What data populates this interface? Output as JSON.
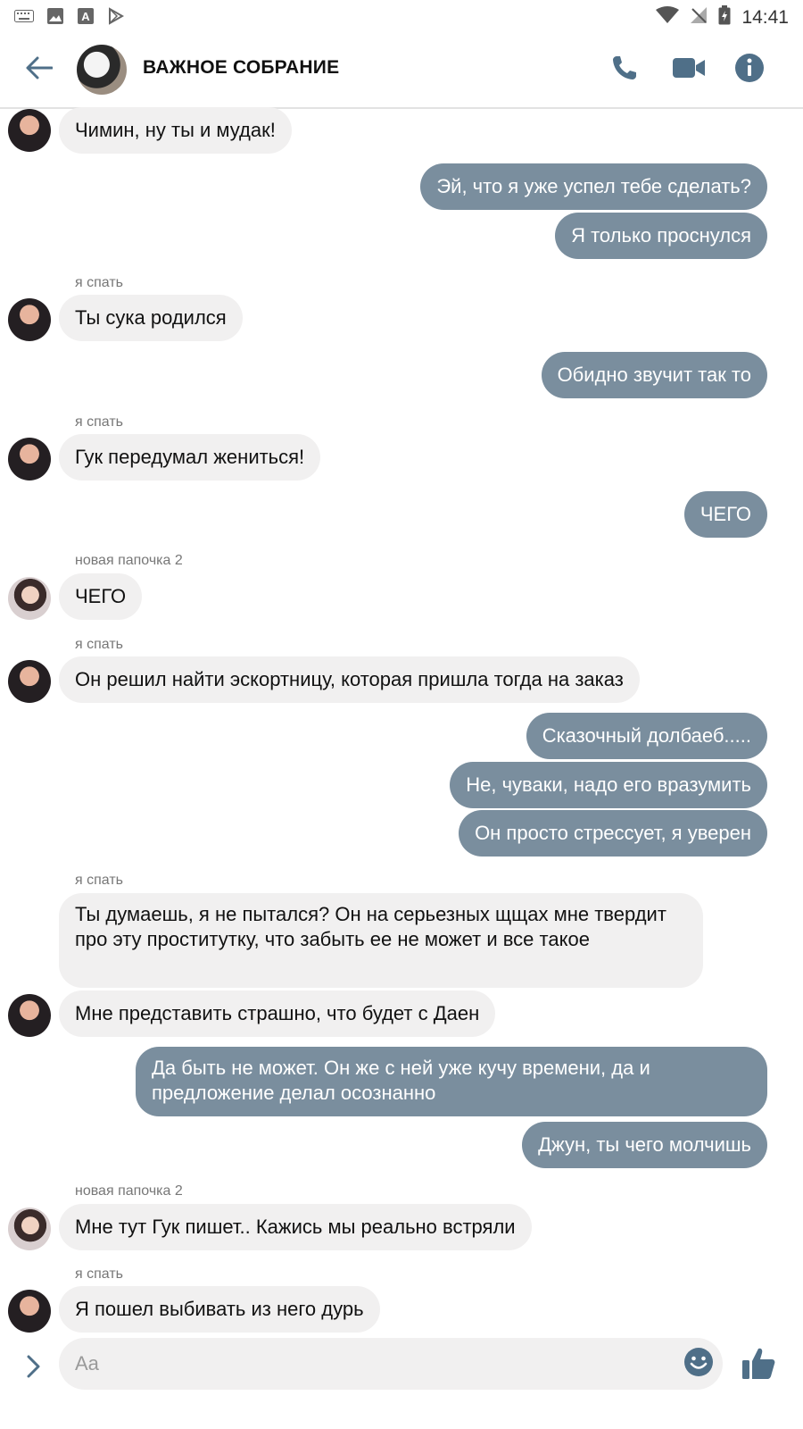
{
  "status_bar": {
    "time": "14:41"
  },
  "header": {
    "title": "ВАЖНОЕ СОБРАНИЕ"
  },
  "messages": [
    {
      "dir": "in",
      "text": "Чимин, ну ты и мудак!"
    },
    {
      "dir": "out",
      "text": "Эй, что я уже успел тебе сделать?"
    },
    {
      "dir": "out",
      "text": "Я только проснулся"
    },
    {
      "dir": "in",
      "sender": "я спать",
      "text": "Ты сука родился"
    },
    {
      "dir": "out",
      "text": "Обидно звучит так то"
    },
    {
      "dir": "in",
      "sender": "я спать",
      "text": "Гук передумал жениться!"
    },
    {
      "dir": "out",
      "text": "ЧЕГО"
    },
    {
      "dir": "in",
      "sender": "новая папочка 2",
      "text": "ЧЕГО"
    },
    {
      "dir": "in",
      "sender": "я спать",
      "text": "Он решил найти эскортницу, которая пришла тогда на заказ"
    },
    {
      "dir": "out",
      "text": "Сказочный долбаеб....."
    },
    {
      "dir": "out",
      "text": "Не, чуваки, надо его вразумить"
    },
    {
      "dir": "out",
      "text": "Он просто стрессует, я уверен"
    },
    {
      "dir": "in",
      "sender": "я спать",
      "text": "Ты думаешь, я не пытался? Он на серьезных щщах мне твердит про эту проститутку, что забыть ее не может и все такое"
    },
    {
      "dir": "in",
      "text": "Мне представить страшно, что будет с Даен"
    },
    {
      "dir": "out",
      "text": "Да быть не может. Он же с ней уже кучу времени, да и предложение делал осознанно"
    },
    {
      "dir": "out",
      "text": "Джун, ты чего молчишь"
    },
    {
      "dir": "in",
      "sender": "новая папочка 2",
      "text": "Мне тут Гук пишет.. Кажись мы реально встряли"
    },
    {
      "dir": "in",
      "sender": "я спать",
      "text": "Я пошел выбивать из него дурь"
    }
  ],
  "composer": {
    "placeholder": "Aa"
  },
  "colors": {
    "outgoing_bubble": "#7a8e9e",
    "incoming_bubble": "#f1f0f0",
    "accent": "#4f6f88"
  },
  "icons": [
    "back-arrow-icon",
    "phone-icon",
    "video-icon",
    "info-icon",
    "chevron-right-icon",
    "emoji-icon",
    "thumbs-up-icon"
  ]
}
